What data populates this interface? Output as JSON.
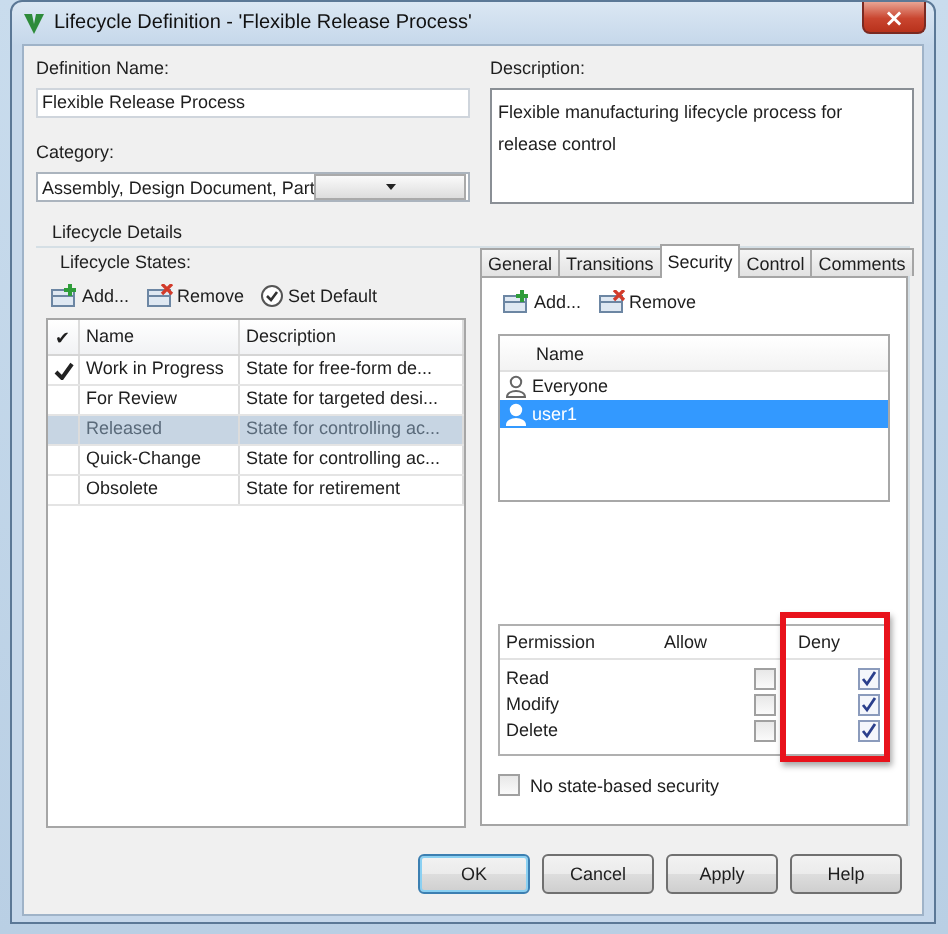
{
  "window": {
    "title": "Lifecycle Definition - 'Flexible Release Process'",
    "close": "×"
  },
  "definition_name": {
    "label": "Definition Name:",
    "value": "Flexible Release Process"
  },
  "category": {
    "label": "Category:",
    "value": "Assembly, Design Document, Part"
  },
  "description": {
    "label": "Description:",
    "value": "Flexible manufacturing lifecycle process for release control"
  },
  "lifecycle_details": {
    "title": "Lifecycle Details",
    "states_label": "Lifecycle States:",
    "toolbar": [
      {
        "kind": "add",
        "label": "Add..."
      },
      {
        "kind": "remove",
        "label": "Remove"
      },
      {
        "kind": "default",
        "label": "Set Default"
      }
    ],
    "columns": [
      "✔",
      "Name",
      "Description"
    ],
    "states": [
      {
        "default": true,
        "name": "Work in Progress",
        "description": "State for free-form de...",
        "selected": false
      },
      {
        "default": false,
        "name": "For Review",
        "description": "State for targeted desi...",
        "selected": false
      },
      {
        "default": false,
        "name": "Released",
        "description": "State for controlling ac...",
        "selected": true
      },
      {
        "default": false,
        "name": "Quick-Change",
        "description": "State for controlling ac...",
        "selected": false
      },
      {
        "default": false,
        "name": "Obsolete",
        "description": "State for retirement",
        "selected": false
      }
    ]
  },
  "tabs": [
    {
      "label": "General",
      "selected": false
    },
    {
      "label": "Transitions",
      "selected": false
    },
    {
      "label": "Security",
      "selected": true
    },
    {
      "label": "Control",
      "selected": false
    },
    {
      "label": "Comments",
      "selected": false
    }
  ],
  "security": {
    "toolbar": [
      {
        "kind": "add",
        "label": "Add..."
      },
      {
        "kind": "remove",
        "label": "Remove"
      }
    ],
    "users_column": "Name",
    "users": [
      {
        "kind": "group",
        "name": "Everyone",
        "selected": false
      },
      {
        "kind": "user",
        "name": "user1",
        "selected": true
      }
    ],
    "permission_columns": [
      "Permission",
      "Allow",
      "Deny"
    ],
    "permissions": [
      {
        "name": "Read",
        "allow": false,
        "deny": true
      },
      {
        "name": "Modify",
        "allow": false,
        "deny": true
      },
      {
        "name": "Delete",
        "allow": false,
        "deny": true
      }
    ],
    "no_state_security": {
      "label": "No state-based security",
      "checked": false
    }
  },
  "buttons": [
    {
      "label": "OK",
      "default": true
    },
    {
      "label": "Cancel",
      "default": false
    },
    {
      "label": "Apply",
      "default": false
    },
    {
      "label": "Help",
      "default": false
    }
  ]
}
